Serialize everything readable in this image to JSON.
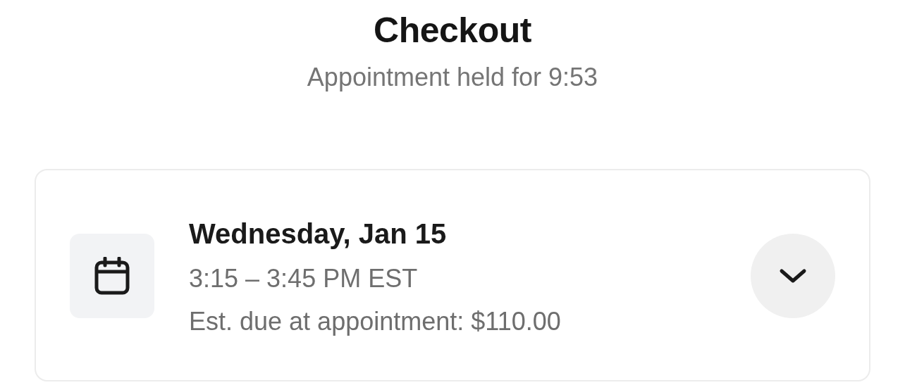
{
  "header": {
    "title": "Checkout",
    "subtitle": "Appointment held for 9:53"
  },
  "appointment": {
    "date": "Wednesday, Jan 15",
    "time": "3:15 – 3:45 PM EST",
    "due": "Est. due at appointment: $110.00",
    "expanded": false
  }
}
